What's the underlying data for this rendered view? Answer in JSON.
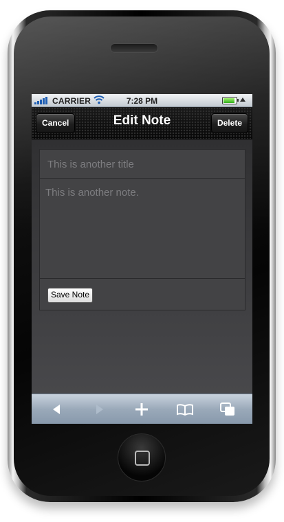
{
  "status_bar": {
    "carrier": "CARRIER",
    "time": "7:28 PM",
    "icons": [
      "signal-icon",
      "wifi-icon",
      "battery-icon",
      "up-arrow-icon"
    ]
  },
  "nav": {
    "title": "Edit Note",
    "cancel_label": "Cancel",
    "delete_label": "Delete"
  },
  "form": {
    "title_value": "This is another title",
    "note_value": "This is another note.",
    "save_label": "Save Note"
  },
  "toolbar": {
    "items": [
      "back-icon",
      "forward-icon",
      "add-icon",
      "bookmarks-icon",
      "pages-icon"
    ]
  },
  "colors": {
    "content_bg": "#3c3c3e",
    "nav_bg": "#1d1d1d",
    "toolbar_bg": "#9aa9b9",
    "battery": "#33b11f"
  }
}
